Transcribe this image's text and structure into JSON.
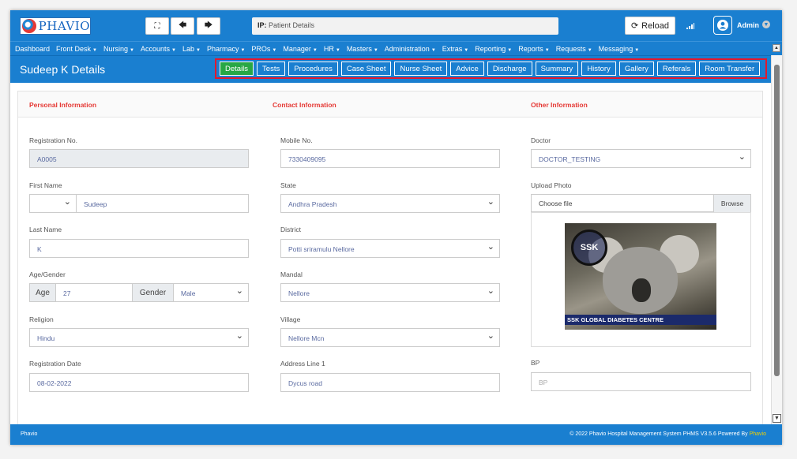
{
  "app": {
    "logo_text": "PHAVIO"
  },
  "toolbar": {
    "expand_icon": "expand-icon",
    "back_icon": "arrow-left-icon",
    "forward_icon": "arrow-right-icon",
    "ip_label": "IP:",
    "ip_value": "Patient Details",
    "reload_label": "Reload",
    "user_label": "Admin"
  },
  "nav": {
    "items": [
      "Dashboard",
      "Front Desk",
      "Nursing",
      "Accounts",
      "Lab",
      "Pharmacy",
      "PROs",
      "Manager",
      "HR",
      "Masters",
      "Administration",
      "Extras",
      "Reporting",
      "Reports",
      "Requests",
      "Messaging"
    ]
  },
  "page": {
    "title": "Sudeep K Details",
    "tabs": [
      "Details",
      "Tests",
      "Procedures",
      "Case Sheet",
      "Nurse Sheet",
      "Advice",
      "Discharge",
      "Summary",
      "History",
      "Gallery",
      "Referals",
      "Room Transfer"
    ],
    "active_tab": "Details"
  },
  "sections": {
    "personal": "Personal Information",
    "contact": "Contact Information",
    "other": "Other Information"
  },
  "personal": {
    "reg_no_label": "Registration No.",
    "reg_no": "A0005",
    "first_name_label": "First Name",
    "title_value": "",
    "first_name": "Sudeep",
    "last_name_label": "Last Name",
    "last_name": "K",
    "age_gender_label": "Age/Gender",
    "age_addon": "Age",
    "age": "27",
    "gender_addon": "Gender",
    "gender": "Male",
    "religion_label": "Religion",
    "religion": "Hindu",
    "reg_date_label": "Registration Date",
    "reg_date": "08-02-2022"
  },
  "contact": {
    "mobile_label": "Mobile No.",
    "mobile": "7330409095",
    "state_label": "State",
    "state": "Andhra Pradesh",
    "district_label": "District",
    "district": "Potti sriramulu Nellore",
    "mandal_label": "Mandal",
    "mandal": "Nellore",
    "village_label": "Village",
    "village": "Nellore Mcn",
    "address_label": "Address Line 1",
    "address": "Dycus road"
  },
  "other": {
    "doctor_label": "Doctor",
    "doctor": "DOCTOR_TESTING",
    "photo_label": "Upload Photo",
    "photo_placeholder": "Choose file",
    "browse_label": "Browse",
    "photo_logo": "SSK",
    "photo_caption": "SSK GLOBAL DIABETES CENTRE",
    "bp_label": "BP",
    "bp_placeholder": "BP"
  },
  "footer": {
    "left": "Phavio",
    "right": "© 2022 Phavio Hospital Management System PHMS V3.5.6 Powered By",
    "brand": "Phavio"
  },
  "colors": {
    "primary": "#1a7fd0",
    "active_tab": "#28a745",
    "highlight": "#e0192f",
    "section_title": "#e53935"
  }
}
